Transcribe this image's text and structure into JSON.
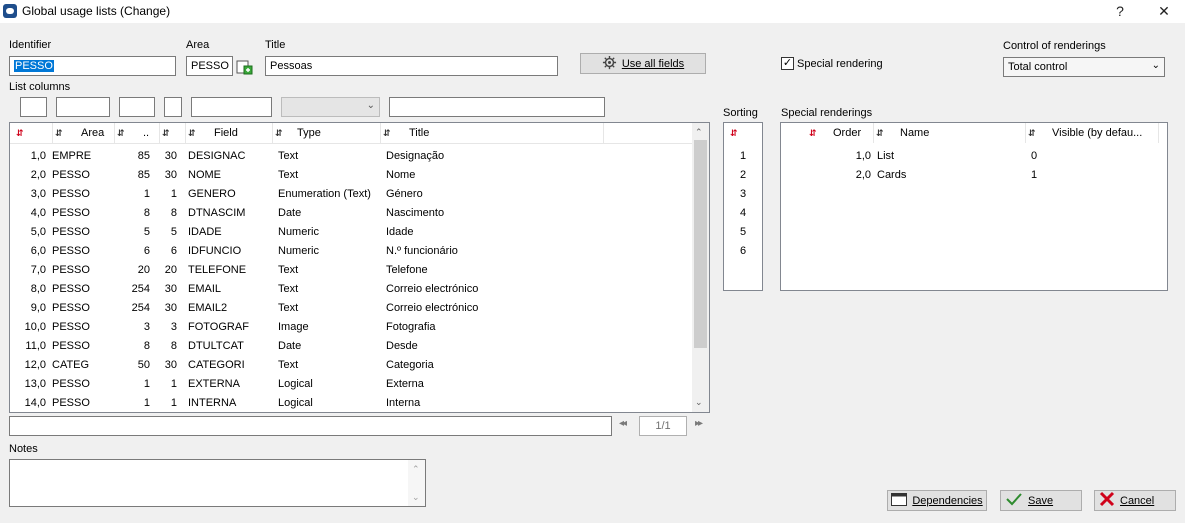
{
  "window": {
    "title": "Global usage lists (Change)",
    "help": "?",
    "close": "✕"
  },
  "form": {
    "identifier_label": "Identifier",
    "identifier_value": "PESSO",
    "area_label": "Area",
    "area_value": "PESSO",
    "title_label": "Title",
    "title_value": "Pessoas",
    "use_all_fields_label": "Use all fields",
    "special_rendering_label": "Special rendering",
    "special_rendering_checked": "✓",
    "control_label": "Control of renderings",
    "control_value": "Total control",
    "list_columns_label": "List columns"
  },
  "columns": {
    "headers": [
      "",
      "Area",
      "..",
      "",
      "Field",
      "Type",
      "Title"
    ],
    "rows": [
      [
        "1,0",
        "EMPRE",
        "85",
        "30",
        "DESIGNAC",
        "Text",
        "Designação"
      ],
      [
        "2,0",
        "PESSO",
        "85",
        "30",
        "NOME",
        "Text",
        "Nome"
      ],
      [
        "3,0",
        "PESSO",
        "1",
        "1",
        "GENERO",
        "Enumeration (Text)",
        "Género"
      ],
      [
        "4,0",
        "PESSO",
        "8",
        "8",
        "DTNASCIM",
        "Date",
        "Nascimento"
      ],
      [
        "5,0",
        "PESSO",
        "5",
        "5",
        "IDADE",
        "Numeric",
        "Idade"
      ],
      [
        "6,0",
        "PESSO",
        "6",
        "6",
        "IDFUNCIO",
        "Numeric",
        "N.º funcionário"
      ],
      [
        "7,0",
        "PESSO",
        "20",
        "20",
        "TELEFONE",
        "Text",
        "Telefone"
      ],
      [
        "8,0",
        "PESSO",
        "254",
        "30",
        "EMAIL",
        "Text",
        "Correio electrónico"
      ],
      [
        "9,0",
        "PESSO",
        "254",
        "30",
        "EMAIL2",
        "Text",
        "Correio electrónico"
      ],
      [
        "10,0",
        "PESSO",
        "3",
        "3",
        "FOTOGRAF",
        "Image",
        "Fotografia"
      ],
      [
        "11,0",
        "PESSO",
        "8",
        "8",
        "DTULTCAT",
        "Date",
        "Desde"
      ],
      [
        "12,0",
        "CATEG",
        "50",
        "30",
        "CATEGORI",
        "Text",
        "Categoria"
      ],
      [
        "13,0",
        "PESSO",
        "1",
        "1",
        "EXTERNA",
        "Logical",
        "Externa"
      ],
      [
        "14,0",
        "PESSO",
        "1",
        "1",
        "INTERNA",
        "Logical",
        "Interna"
      ]
    ],
    "scroll_fraction": 0.0
  },
  "sorting": {
    "label": "Sorting",
    "values": [
      "1",
      "2",
      "3",
      "4",
      "5",
      "6"
    ]
  },
  "special_renderings": {
    "label": "Special renderings",
    "headers": [
      "Order",
      "Name",
      "Visible (by defau..."
    ],
    "rows": [
      [
        "1,0",
        "List",
        "0"
      ],
      [
        "2,0",
        "Cards",
        "1"
      ]
    ]
  },
  "pager": {
    "text": "1/1",
    "prev": "◂◂",
    "next": "▸▸"
  },
  "notes": {
    "label": "Notes",
    "value": ""
  },
  "buttons": {
    "dependencies": "Dependencies",
    "save": "Save",
    "cancel": "Cancel"
  },
  "colors": {
    "selection": "#0078d7",
    "save_check": "#2e8b2e",
    "cancel_x": "#d0021b",
    "sort_icon_red": "#d0021b"
  }
}
